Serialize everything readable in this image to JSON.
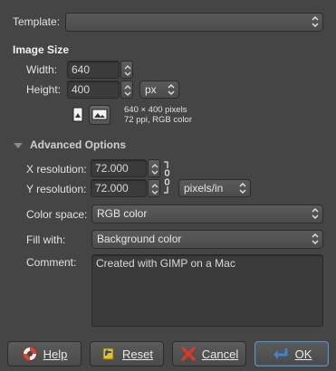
{
  "template": {
    "label": "Template:",
    "value": ""
  },
  "image_size": {
    "heading": "Image Size",
    "width_label": "Width:",
    "width_value": "640",
    "height_label": "Height:",
    "height_value": "400",
    "unit": "px",
    "info_line1": "640 × 400 pixels",
    "info_line2": "72 ppi, RGB color"
  },
  "advanced": {
    "heading": "Advanced Options",
    "x_res_label": "X resolution:",
    "x_res_value": "72.000",
    "y_res_label": "Y resolution:",
    "y_res_value": "72.000",
    "res_unit": "pixels/in",
    "color_space_label": "Color space:",
    "color_space_value": "RGB color",
    "fill_label": "Fill with:",
    "fill_value": "Background color",
    "comment_label": "Comment:",
    "comment_value": "Created with GIMP on a Mac"
  },
  "buttons": {
    "help": "Help",
    "reset": "Reset",
    "cancel": "Cancel",
    "ok": "OK"
  },
  "colors": {
    "background": "#454545",
    "help_icon": "#d8462f",
    "reset_icon": "#e8c12a",
    "cancel_icon": "#d63a2a",
    "ok_icon": "#3d82d6"
  }
}
